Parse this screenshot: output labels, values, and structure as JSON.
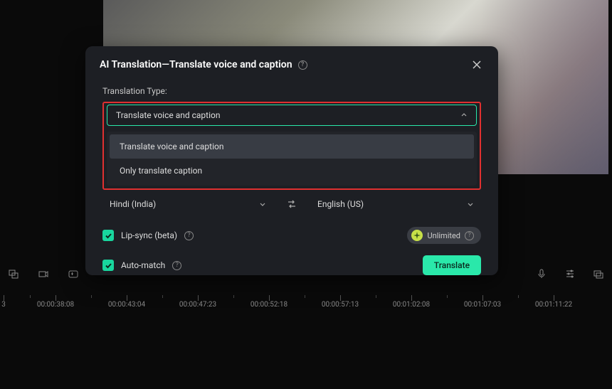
{
  "dialog": {
    "title": "AI Translation—Translate voice and caption",
    "translation_type_label": "Translation Type:",
    "selected_type": "Translate voice and caption",
    "options": [
      "Translate voice and caption",
      "Only translate caption"
    ],
    "source_lang": "Hindi (India)",
    "target_lang": "English (US)",
    "lipsync_label": "Lip-sync (beta)",
    "automatch_label": "Auto-match",
    "unlimited_badge": "Unlimited",
    "translate_button": "Translate"
  },
  "timeline": {
    "labels": [
      {
        "pos": 5,
        "text": "3"
      },
      {
        "pos": 78,
        "text": "00:00:38:08"
      },
      {
        "pos": 178,
        "text": "00:00:43:04"
      },
      {
        "pos": 278,
        "text": "00:00:47:23"
      },
      {
        "pos": 378,
        "text": "00:00:52:18"
      },
      {
        "pos": 478,
        "text": "00:00:57:13"
      },
      {
        "pos": 578,
        "text": "00:01:02:08"
      },
      {
        "pos": 678,
        "text": "00:01:07:03"
      },
      {
        "pos": 778,
        "text": "00:01:11:22"
      }
    ]
  }
}
